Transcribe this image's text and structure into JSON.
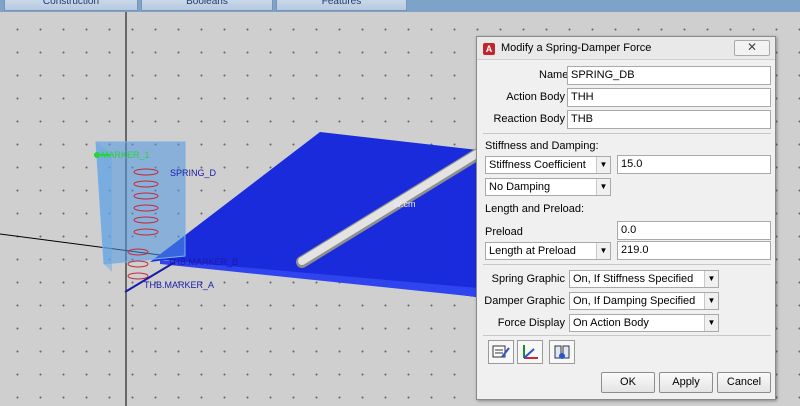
{
  "toolbar": {
    "tabs": [
      {
        "label": "Construction"
      },
      {
        "label": "Booleans"
      },
      {
        "label": "Features"
      }
    ]
  },
  "viewport": {
    "labels": {
      "marker_top": "MARKER_1",
      "marker_d": "SPRING_D",
      "marker_b": "THB.MARKER_B",
      "marker_a": "THB.MARKER_A",
      "cm": "W.cm"
    }
  },
  "dialog": {
    "app_icon": "A",
    "title": "Modify a Spring-Damper Force",
    "close_glyph": "✕",
    "name": {
      "label": "Name",
      "value": "SPRING_DB"
    },
    "action_body": {
      "label": "Action Body",
      "value": "THH"
    },
    "reaction_body": {
      "label": "Reaction Body",
      "value": "THB"
    },
    "stiffness_section": "Stiffness and Damping:",
    "stiffness_select": "Stiffness Coefficient",
    "stiffness_value": "15.0",
    "damping_select": "No Damping",
    "length_section": "Length and Preload:",
    "preload": {
      "label": "Preload",
      "value": "0.0"
    },
    "length_select": "Length at Preload",
    "length_value": "219.0",
    "spring_graphic": {
      "label": "Spring Graphic",
      "value": "On, If Stiffness Specified"
    },
    "damper_graphic": {
      "label": "Damper Graphic",
      "value": "On, If Damping Specified"
    },
    "force_display": {
      "label": "Force Display",
      "value": "On Action Body"
    },
    "icons": [
      "edit-table-icon",
      "coordinate-axes-icon",
      "measure-icon"
    ],
    "ok_label": "OK",
    "apply_label": "Apply",
    "cancel_label": "Cancel"
  },
  "colors": {
    "plate": "#1a2bdc",
    "box": "#3d87d8",
    "accent_marker": "#28d23a"
  }
}
